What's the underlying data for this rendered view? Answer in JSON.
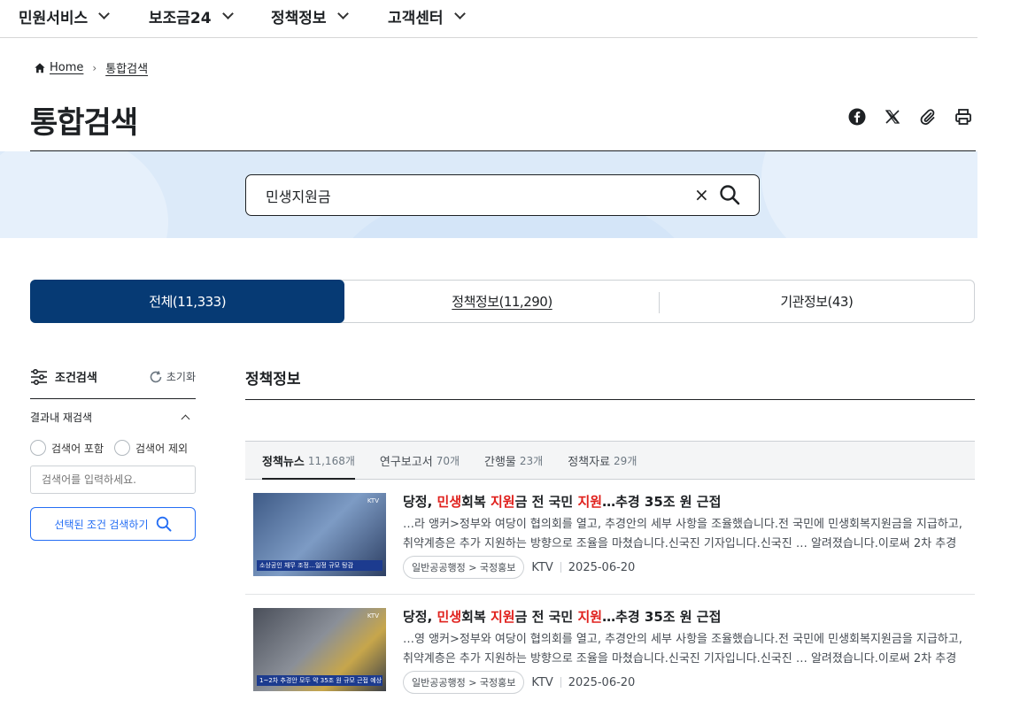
{
  "nav": {
    "items": [
      "민원서비스",
      "보조금24",
      "정책정보",
      "고객센터"
    ]
  },
  "breadcrumb": {
    "home": "Home",
    "current": "통합검색"
  },
  "page": {
    "title": "통합검색"
  },
  "share": {
    "icons": [
      "facebook-icon",
      "x-icon",
      "link-icon",
      "print-icon"
    ]
  },
  "search": {
    "value": "민생지원금",
    "clear_label": "×"
  },
  "tabs": [
    {
      "label": "전체(11,333)",
      "active": true
    },
    {
      "label": "정책정보(11,290)",
      "active": false
    },
    {
      "label": "기관정보(43)",
      "active": false
    }
  ],
  "filter": {
    "title": "조건검색",
    "reset": "초기화",
    "re_search": "결과내 재검색",
    "include": "검색어 포함",
    "exclude": "검색어 제외",
    "placeholder": "검색어를 입력하세요.",
    "button": "선택된 조건 검색하기"
  },
  "section": {
    "title": "정책정보"
  },
  "subtabs": [
    {
      "label": "정책뉴스",
      "count": "11,168개",
      "active": true
    },
    {
      "label": "연구보고서",
      "count": "70개",
      "active": false
    },
    {
      "label": "간행물",
      "count": "23개",
      "active": false
    },
    {
      "label": "정책자료",
      "count": "29개",
      "active": false
    }
  ],
  "results": [
    {
      "title_parts": {
        "p1": "당정, ",
        "h1": "민생",
        "p2": "회복 ",
        "h2": "지원",
        "p3": "금 전 국민 ",
        "h3": "지원",
        "p4": "…추경 35조 원 근접"
      },
      "desc": "…라 앵커>정부와 여당이 협의회를 열고, 추경안의 세부 사항을 조율했습니다.전 국민에 민생회복지원금을 지급하고, 취약계층은 추가 지원하는 방향으로 조율을 마쳤습니다.신국진 기자입니다.신국진 … 알려졌습니다.이로써 2차 추경 규모…",
      "category": "일반공공행정 > 국정홍보",
      "source": "KTV",
      "date": "2025-06-20",
      "thumb_caption": "소상공인 채무 조정…일정 규모 탕감",
      "thumb_logo": "KTV"
    },
    {
      "title_parts": {
        "p1": "당정, ",
        "h1": "민생",
        "p2": "회복 ",
        "h2": "지원",
        "p3": "금 전 국민 ",
        "h3": "지원",
        "p4": "…추경 35조 원 근접"
      },
      "desc": "…영 앵커>정부와 여당이 협의회를 열고, 추경안의 세부 사항을 조율했습니다.전 국민에 민생회복지원금을 지급하고, 취약계층은 추가 지원하는 방향으로 조율을 마쳤습니다.신국진 기자입니다.신국진 … 알려졌습니다.이로써 2차 추경 규모…",
      "category": "일반공공행정 > 국정홍보",
      "source": "KTV",
      "date": "2025-06-20",
      "thumb_caption": "1~2차 추경안 모두 약 35조 원 규모 근접 예상",
      "thumb_logo": "KTV"
    }
  ],
  "colors": {
    "primary": "#063a74",
    "highlight": "#e0201c",
    "link_blue": "#256ef4",
    "hero_bg": "#dceaf9"
  }
}
